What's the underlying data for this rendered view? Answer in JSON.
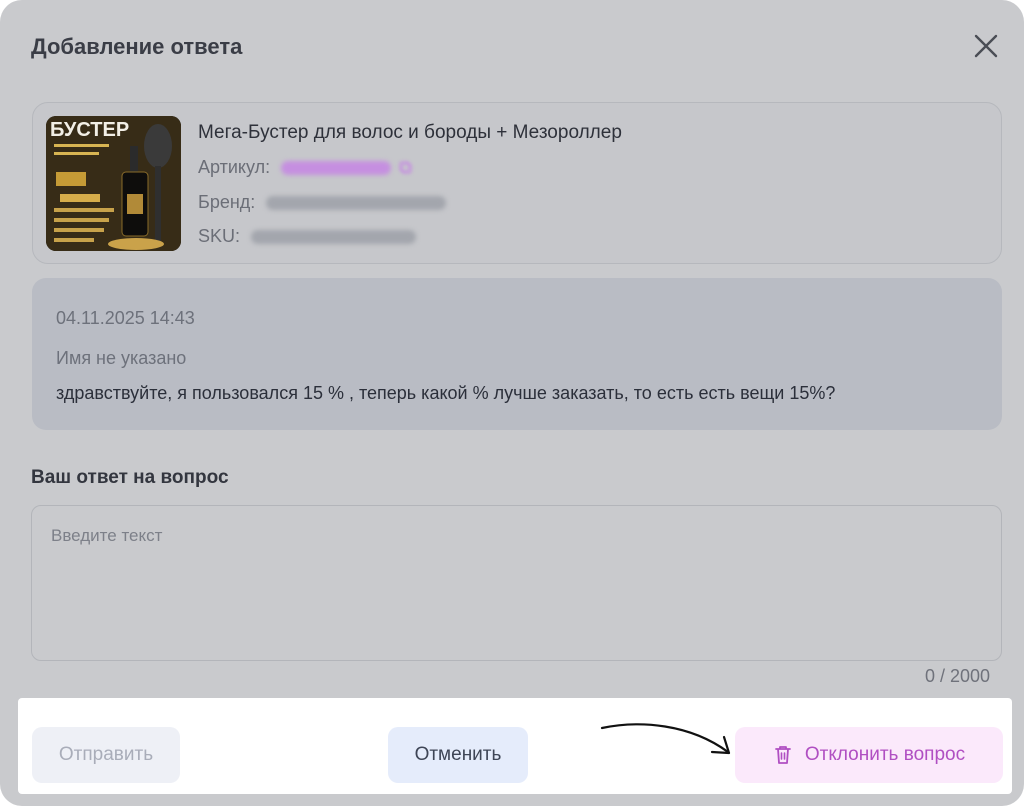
{
  "modal": {
    "title": "Добавление ответа",
    "close_icon": "close-icon"
  },
  "product": {
    "name": "Мега-Бустер для волос и бороды + Мезороллер",
    "article_label": "Артикул:",
    "brand_label": "Бренд:",
    "sku_label": "SKU:",
    "thumbnail_text": "БУСТЕР",
    "copy_icon": "copy-icon"
  },
  "question": {
    "date": "04.11.2025 14:43",
    "author": "Имя не указано",
    "text": "здравствуйте, я пользовался 15 % , теперь какой % лучше заказать, то есть есть вещи 15%?"
  },
  "answer": {
    "label": "Ваш ответ на вопрос",
    "placeholder": "Введите текст",
    "value": "",
    "counter": "0 / 2000"
  },
  "footer": {
    "send_label": "Отправить",
    "cancel_label": "Отменить",
    "reject_label": "Отклонить вопрос",
    "reject_icon": "trash-icon"
  },
  "colors": {
    "overlay": "#c9cacd",
    "reject_text": "#b04fc2",
    "reject_bg": "#fbe9fb",
    "cancel_bg": "#e5ecfb",
    "article_accent": "#c58fe0"
  }
}
